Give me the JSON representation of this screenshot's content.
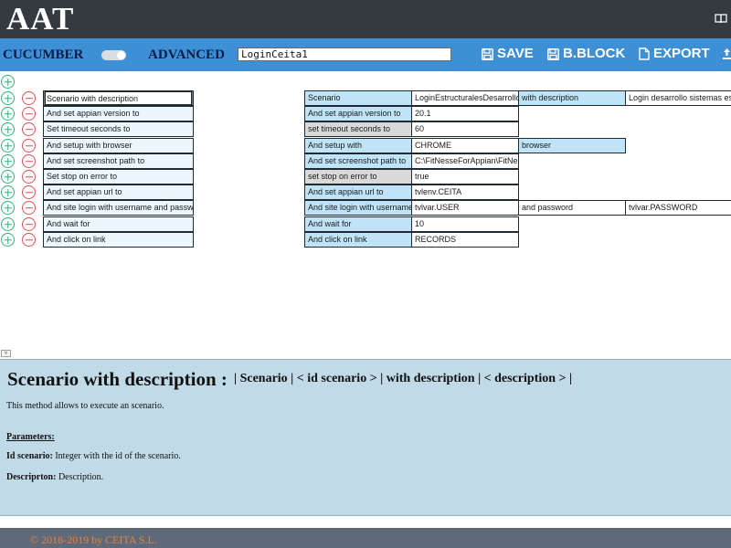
{
  "app": {
    "logo": "AAT",
    "help_icon": "book-icon"
  },
  "toolbar": {
    "mode_label": "CUCUMBER",
    "advanced_label": "ADVANCED",
    "test_name_value": "LoginCeita1",
    "save_label": "SAVE",
    "bblock_label": "B.BLOCK",
    "export_label": "EXPORT"
  },
  "left_steps": [
    "Scenario with description",
    "And set appian version to",
    "Set timeout seconds to",
    "And setup with browser",
    "And set screenshot path to",
    "Set stop on error to",
    "And set appian url to",
    "And site login with username and passw",
    "And wait for",
    "And click on link"
  ],
  "right_rows": [
    {
      "key": "Scenario",
      "value": "LoginEstructuralesDesarrollo",
      "ext1": "with description",
      "ext2": "Login desarrollo sistemas es"
    },
    {
      "key": "And set appian version to",
      "value": "20.1"
    },
    {
      "key": "set timeout seconds to",
      "value": "60"
    },
    {
      "key": "And setup with",
      "value": "CHROME",
      "ext1": "browser"
    },
    {
      "key": "And set screenshot path to",
      "value": "C:\\FitNesseForAppian\\FitNes"
    },
    {
      "key": "set stop on error to",
      "value": "true"
    },
    {
      "key": "And set appian url to",
      "value": "tvlenv.CEITA"
    },
    {
      "key": "And site login with username",
      "value": "tvlvar.USER",
      "ext1": "and password",
      "ext2": "tvlvar.PASSWORD"
    },
    {
      "key": "And wait for",
      "value": "10"
    },
    {
      "key": "And click on link",
      "value": "RECORDS"
    }
  ],
  "help": {
    "collapse_glyph": "v",
    "title": "Scenario with description :",
    "syntax": "| Scenario | < id scenario > | with description | < description > |",
    "description": "This method allows to execute an scenario.",
    "params_heading": "Parameters:",
    "param1_name": "Id scenario:",
    "param1_text": " Integer with the id of the scenario.",
    "param2_name": "Descriprton:",
    "param2_text": " Description."
  },
  "footer": {
    "copyright": "© 2018-2019 by CEITA S.L."
  },
  "colors": {
    "header_bg": "#343a40",
    "toolbar_bg": "#3d8fd6",
    "key_cell": "#bfe4f7",
    "help_bg": "#c1dae8",
    "footer_bg": "#5e6a7a",
    "footer_text": "#e9813a",
    "add_icon": "#2bb37a",
    "remove_icon": "#e24f4f"
  }
}
